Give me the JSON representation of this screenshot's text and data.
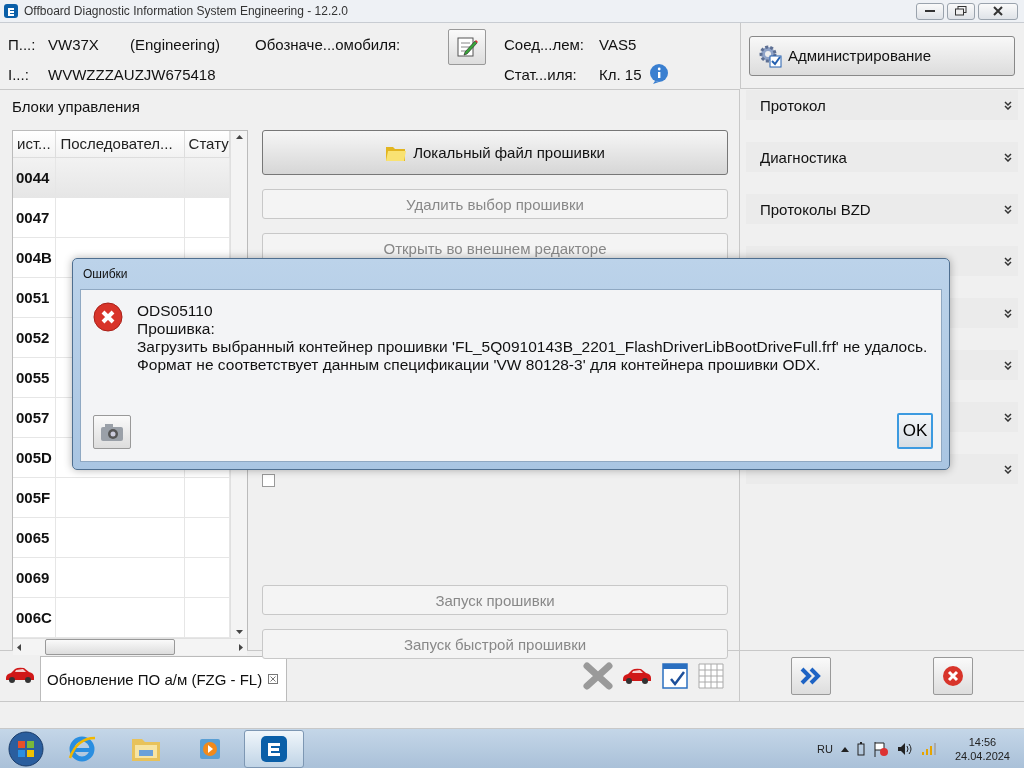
{
  "window": {
    "title": "Offboard Diagnostic Information System Engineering - 12.2.0"
  },
  "header": {
    "project_label": "П...:",
    "project": "VW37X",
    "project_mode": "(Engineering)",
    "vehicle_label": "Обозначе...омобиля:",
    "vin_label": "I...:",
    "vin": "WVWZZZAUZJW675418",
    "connection_label": "Соед...лем:",
    "connection": "VAS5",
    "state_label": "Стат...иля:",
    "state": "Кл. 15"
  },
  "admin_button": {
    "label": "Администрирование"
  },
  "control_units": {
    "title": "Блоки управления",
    "columns": [
      "ист...",
      "Последовател...",
      "Стату"
    ],
    "rows": [
      {
        "address": "0044",
        "selected": true
      },
      {
        "address": "0047",
        "selected": false
      },
      {
        "address": "004B",
        "selected": false
      },
      {
        "address": "0051",
        "selected": false
      },
      {
        "address": "0052",
        "selected": false
      },
      {
        "address": "0055",
        "selected": false
      },
      {
        "address": "0057",
        "selected": false
      },
      {
        "address": "005D",
        "selected": false
      },
      {
        "address": "005F",
        "selected": false
      },
      {
        "address": "0065",
        "selected": false
      },
      {
        "address": "0069",
        "selected": false
      },
      {
        "address": "006C",
        "selected": false
      }
    ]
  },
  "actions_top": [
    {
      "label": "Локальный файл прошивки",
      "disabled": false
    },
    {
      "label": "Удалить выбор прошивки",
      "disabled": true
    },
    {
      "label": "Открыть во внешнем редакторе",
      "disabled": true
    }
  ],
  "interface_checkbox": {
    "checked": false
  },
  "actions_bottom": [
    {
      "label": "Запуск прошивки",
      "disabled": true
    },
    {
      "label": "Запуск быстрой прошивки",
      "disabled": true
    }
  ],
  "sidebar": {
    "items": [
      {
        "label": "Протокол",
        "expanded": false
      },
      {
        "label": "Диагностика",
        "expanded": false
      },
      {
        "label": "Протоколы BZD",
        "expanded": false
      },
      {
        "expanded": false
      },
      {
        "expanded": false
      },
      {
        "expanded": false
      },
      {
        "expanded": false
      },
      {
        "expanded": false
      }
    ]
  },
  "tab": {
    "label": "Обновление ПО а/м (FZG - FL)",
    "selected": true
  },
  "dialog": {
    "title": "Ошибки",
    "lines": [
      "ODS05110",
      "Прошивка:",
      "Загрузить выбранный контейнер прошивки 'FL_5Q0910143B_2201_FlashDriverLibBootDriveFull.frf' не удалось.",
      "Формат не соответствует данным спецификации 'VW 80128-3' для контейнера прошивки ODX."
    ],
    "ok": "OK"
  },
  "taskbar": {
    "apps": [
      {
        "kind": "browser",
        "selected": false
      },
      {
        "kind": "files",
        "selected": false
      },
      {
        "kind": "media",
        "selected": false
      },
      {
        "kind": "odis",
        "selected": true
      }
    ],
    "language": "RU",
    "time": "14:56",
    "date": "24.04.2024"
  }
}
